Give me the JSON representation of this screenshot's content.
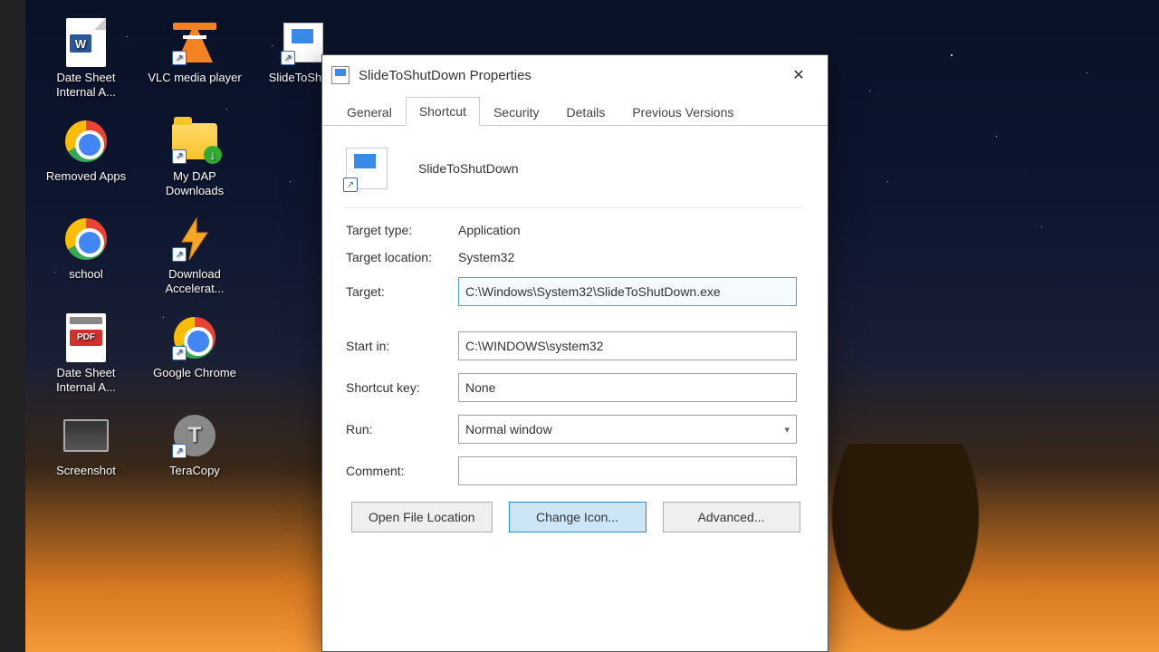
{
  "desktop": {
    "icons": [
      {
        "label": "Date Sheet Internal A..."
      },
      {
        "label": "VLC media player"
      },
      {
        "label": "SlideToShu..."
      },
      {
        "label": "Removed Apps"
      },
      {
        "label": "My DAP Downloads"
      },
      {
        "label": "school"
      },
      {
        "label": "Download Accelerat..."
      },
      {
        "label": "Date Sheet Internal A..."
      },
      {
        "label": "Google Chrome"
      },
      {
        "label": "Screenshot"
      },
      {
        "label": "TeraCopy"
      }
    ]
  },
  "dialog": {
    "title": "SlideToShutDown Properties",
    "tabs": [
      "General",
      "Shortcut",
      "Security",
      "Details",
      "Previous Versions"
    ],
    "active_tab": "Shortcut",
    "name": "SlideToShutDown",
    "fields": {
      "target_type_label": "Target type:",
      "target_type_value": "Application",
      "target_location_label": "Target location:",
      "target_location_value": "System32",
      "target_label": "Target:",
      "target_value": "C:\\Windows\\System32\\SlideToShutDown.exe",
      "start_in_label": "Start in:",
      "start_in_value": "C:\\WINDOWS\\system32",
      "shortcut_key_label": "Shortcut key:",
      "shortcut_key_value": "None",
      "run_label": "Run:",
      "run_value": "Normal window",
      "comment_label": "Comment:",
      "comment_value": ""
    },
    "buttons": {
      "open_file": "Open File Location",
      "change_icon": "Change Icon...",
      "advanced": "Advanced..."
    }
  }
}
